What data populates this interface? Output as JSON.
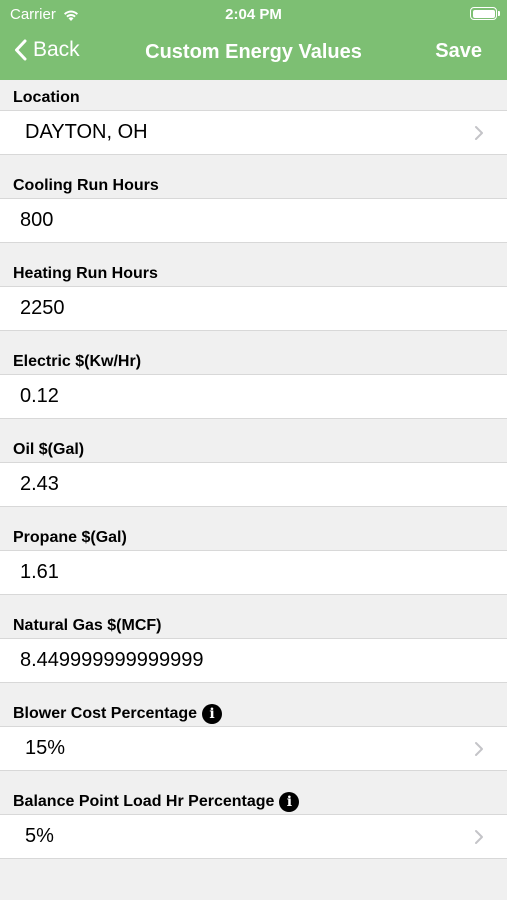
{
  "status": {
    "carrier": "Carrier",
    "time": "2:04 PM"
  },
  "nav": {
    "back_label": "Back",
    "title": "Custom Energy Values",
    "save_label": "Save"
  },
  "fields": [
    {
      "label": "Location",
      "value": "DAYTON, OH",
      "type": "select"
    },
    {
      "label": "Cooling Run Hours",
      "value": "800",
      "type": "input"
    },
    {
      "label": "Heating Run Hours",
      "value": "2250",
      "type": "input"
    },
    {
      "label": "Electric $(Kw/Hr)",
      "value": "0.12",
      "type": "input"
    },
    {
      "label": "Oil $(Gal)",
      "value": "2.43",
      "type": "input"
    },
    {
      "label": "Propane $(Gal)",
      "value": "1.61",
      "type": "input"
    },
    {
      "label": "Natural Gas $(MCF)",
      "value": "8.449999999999999",
      "type": "input"
    },
    {
      "label": "Blower Cost Percentage",
      "value": "15%",
      "type": "select",
      "info": true
    },
    {
      "label": "Balance Point Load Hr Percentage",
      "value": "5%",
      "type": "select",
      "info": true
    }
  ],
  "colors": {
    "nav_bar": "#7dbf73",
    "background": "#f0f0f0",
    "chevron": "#c4c4c8"
  },
  "icons": {
    "back": "chevron-left-icon",
    "disclosure": "chevron-right-icon",
    "info": "info-icon",
    "wifi": "wifi-icon",
    "battery": "battery-icon"
  }
}
